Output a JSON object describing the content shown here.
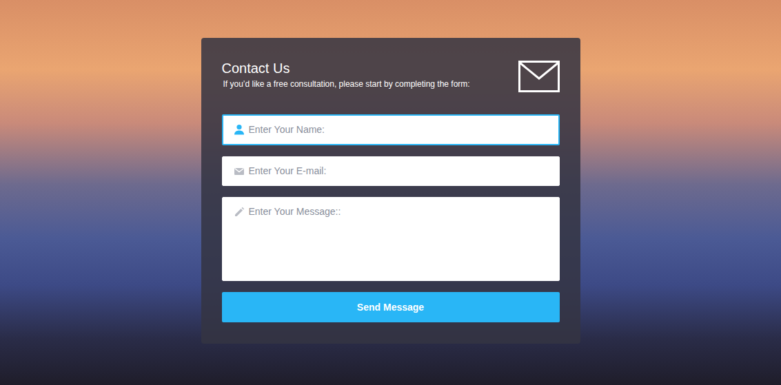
{
  "card": {
    "title": "Contact Us",
    "subtitle": "If you’d like a free consultation, please start by completing the form:"
  },
  "fields": [
    {
      "placeholder": "Enter Your Name:",
      "kind": "input",
      "focused": true
    },
    {
      "placeholder": "Enter Your E-mail:",
      "kind": "input",
      "focused": false
    },
    {
      "placeholder": "Enter Your Message::",
      "kind": "textarea",
      "focused": false
    }
  ],
  "button": {
    "label": "Send Message"
  }
}
